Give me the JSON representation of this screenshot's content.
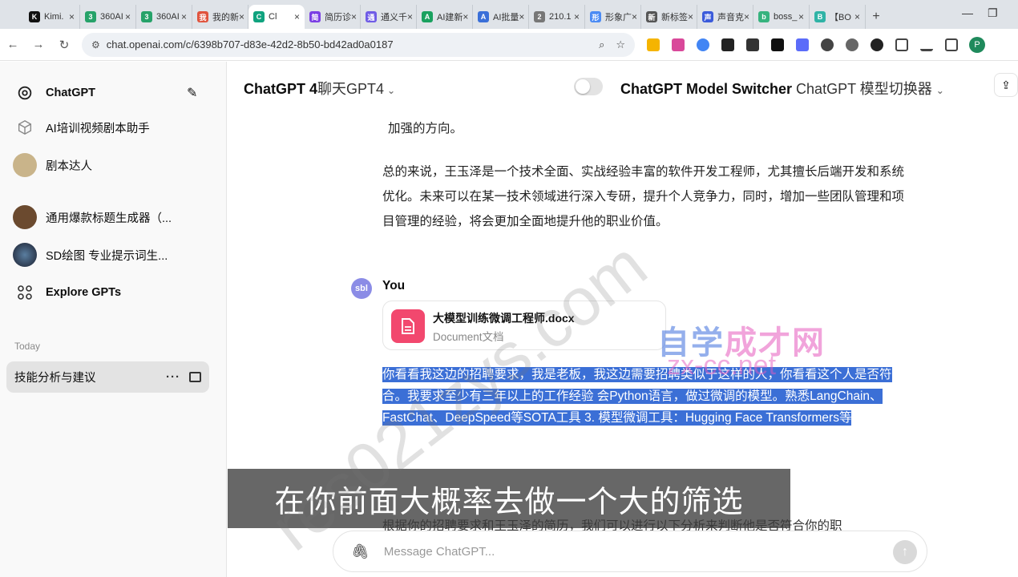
{
  "browser": {
    "tabs": [
      {
        "label": "Kimi.",
        "color": "#111111",
        "glyph": "K"
      },
      {
        "label": "360AI",
        "color": "#26a269",
        "glyph": "3"
      },
      {
        "label": "360AI",
        "color": "#26a269",
        "glyph": "3"
      },
      {
        "label": "我的新",
        "color": "#e0533d",
        "glyph": "我"
      },
      {
        "label": "Cl",
        "color": "#10a37f",
        "glyph": "C",
        "active": true
      },
      {
        "label": "简历诊",
        "color": "#7b3fe4",
        "glyph": "简"
      },
      {
        "label": "通义千",
        "color": "#6f5ce6",
        "glyph": "通"
      },
      {
        "label": "AI建新",
        "color": "#1aa15f",
        "glyph": "A"
      },
      {
        "label": "AI批量",
        "color": "#3a6fd8",
        "glyph": "A"
      },
      {
        "label": "210.1",
        "color": "#777777",
        "glyph": "2"
      },
      {
        "label": "形象广",
        "color": "#4b8bf4",
        "glyph": "形"
      },
      {
        "label": "新标签",
        "color": "#555555",
        "glyph": "新"
      },
      {
        "label": "声音克",
        "color": "#3b5bdb",
        "glyph": "声"
      },
      {
        "label": "boss_",
        "color": "#36b37e",
        "glyph": "b"
      },
      {
        "label": "【BO",
        "color": "#2fb3a6",
        "glyph": "B"
      }
    ],
    "url": "chat.openai.com/c/6398b707-d83e-42d2-8b50-bd42ad0a0187",
    "profile_initial": "P"
  },
  "sidebar": {
    "brand": "ChatGPT",
    "gpts": [
      {
        "label": "AI培训视频剧本助手",
        "icon": "cube-icon"
      },
      {
        "label": "剧本达人",
        "icon": "avatar-icon"
      },
      {
        "label": "通用爆款标题生成器（...",
        "icon": "avatar-icon"
      },
      {
        "label": "SD绘图 专业提示词生...",
        "icon": "avatar-icon"
      }
    ],
    "explore": "Explore GPTs",
    "section_today": "Today",
    "active_chat": "技能分析与建议"
  },
  "header": {
    "model": "ChatGPT 4",
    "model_zh": "聊天GPT4",
    "switcher": "ChatGPT Model Switcher",
    "switcher_zh": "ChatGPT 模型切换器"
  },
  "conversation": {
    "assistant_tail": "加强的方向。",
    "assistant_summary": "总的来说，王玉泽是一个技术全面、实战经验丰富的软件开发工程师，尤其擅长后端开发和系统优化。未来可以在某一技术领域进行深入专研，提升个人竞争力，同时，增加一些团队管理和项目管理的经验，将会更加全面地提升他的职业价值。",
    "user_name": "You",
    "user_avatar": "sbl",
    "attachment_name": "大模型训练微调工程师.docx",
    "attachment_type": "Document文档",
    "user_message": "你看看我这边的招聘要求，我是老板，我这边需要招聘类似于这样的人，你看看这个人是否符合。我要求至少有三年以上的工作经验 会Python语言，做过微调的模型。熟悉LangChain、FastChat、DeepSpeed等SOTA工具 3. 模型微调工具：Hugging Face Transformers等",
    "reply_partial": "根据你的招聘要求和王玉泽的简历，我们可以进行以下分析来判断他是否符合你的职"
  },
  "composer": {
    "placeholder": "Message ChatGPT..."
  },
  "overlay": {
    "caption": "在你前面大概率去做一个大的筛选",
    "watermark_cn_a": "自学",
    "watermark_cn_b": "成才网",
    "watermark_url": "zx-cc.net",
    "watermark_diag": "res021zys.com"
  }
}
